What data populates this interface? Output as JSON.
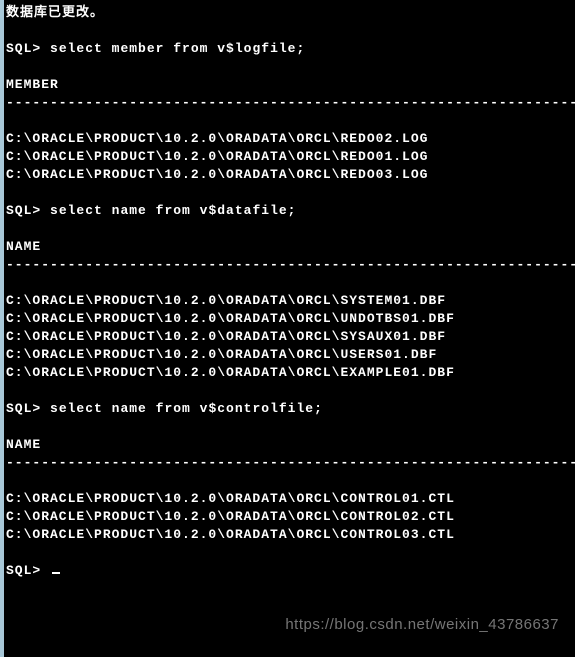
{
  "terminal": {
    "status_message": "数据库已更改。",
    "prompt": "SQL>",
    "dashes": "--------------------------------------------------------------------",
    "queries": {
      "q1": {
        "sql": "select member from v$logfile;",
        "header": "MEMBER",
        "rows": [
          "C:\\ORACLE\\PRODUCT\\10.2.0\\ORADATA\\ORCL\\REDO02.LOG",
          "C:\\ORACLE\\PRODUCT\\10.2.0\\ORADATA\\ORCL\\REDO01.LOG",
          "C:\\ORACLE\\PRODUCT\\10.2.0\\ORADATA\\ORCL\\REDO03.LOG"
        ]
      },
      "q2": {
        "sql": "select name from v$datafile;",
        "header": "NAME",
        "rows": [
          "C:\\ORACLE\\PRODUCT\\10.2.0\\ORADATA\\ORCL\\SYSTEM01.DBF",
          "C:\\ORACLE\\PRODUCT\\10.2.0\\ORADATA\\ORCL\\UNDOTBS01.DBF",
          "C:\\ORACLE\\PRODUCT\\10.2.0\\ORADATA\\ORCL\\SYSAUX01.DBF",
          "C:\\ORACLE\\PRODUCT\\10.2.0\\ORADATA\\ORCL\\USERS01.DBF",
          "C:\\ORACLE\\PRODUCT\\10.2.0\\ORADATA\\ORCL\\EXAMPLE01.DBF"
        ]
      },
      "q3": {
        "sql": "select name from v$controlfile;",
        "header": "NAME",
        "rows": [
          "C:\\ORACLE\\PRODUCT\\10.2.0\\ORADATA\\ORCL\\CONTROL01.CTL",
          "C:\\ORACLE\\PRODUCT\\10.2.0\\ORADATA\\ORCL\\CONTROL02.CTL",
          "C:\\ORACLE\\PRODUCT\\10.2.0\\ORADATA\\ORCL\\CONTROL03.CTL"
        ]
      }
    }
  },
  "watermark": "https://blog.csdn.net/weixin_43786637"
}
